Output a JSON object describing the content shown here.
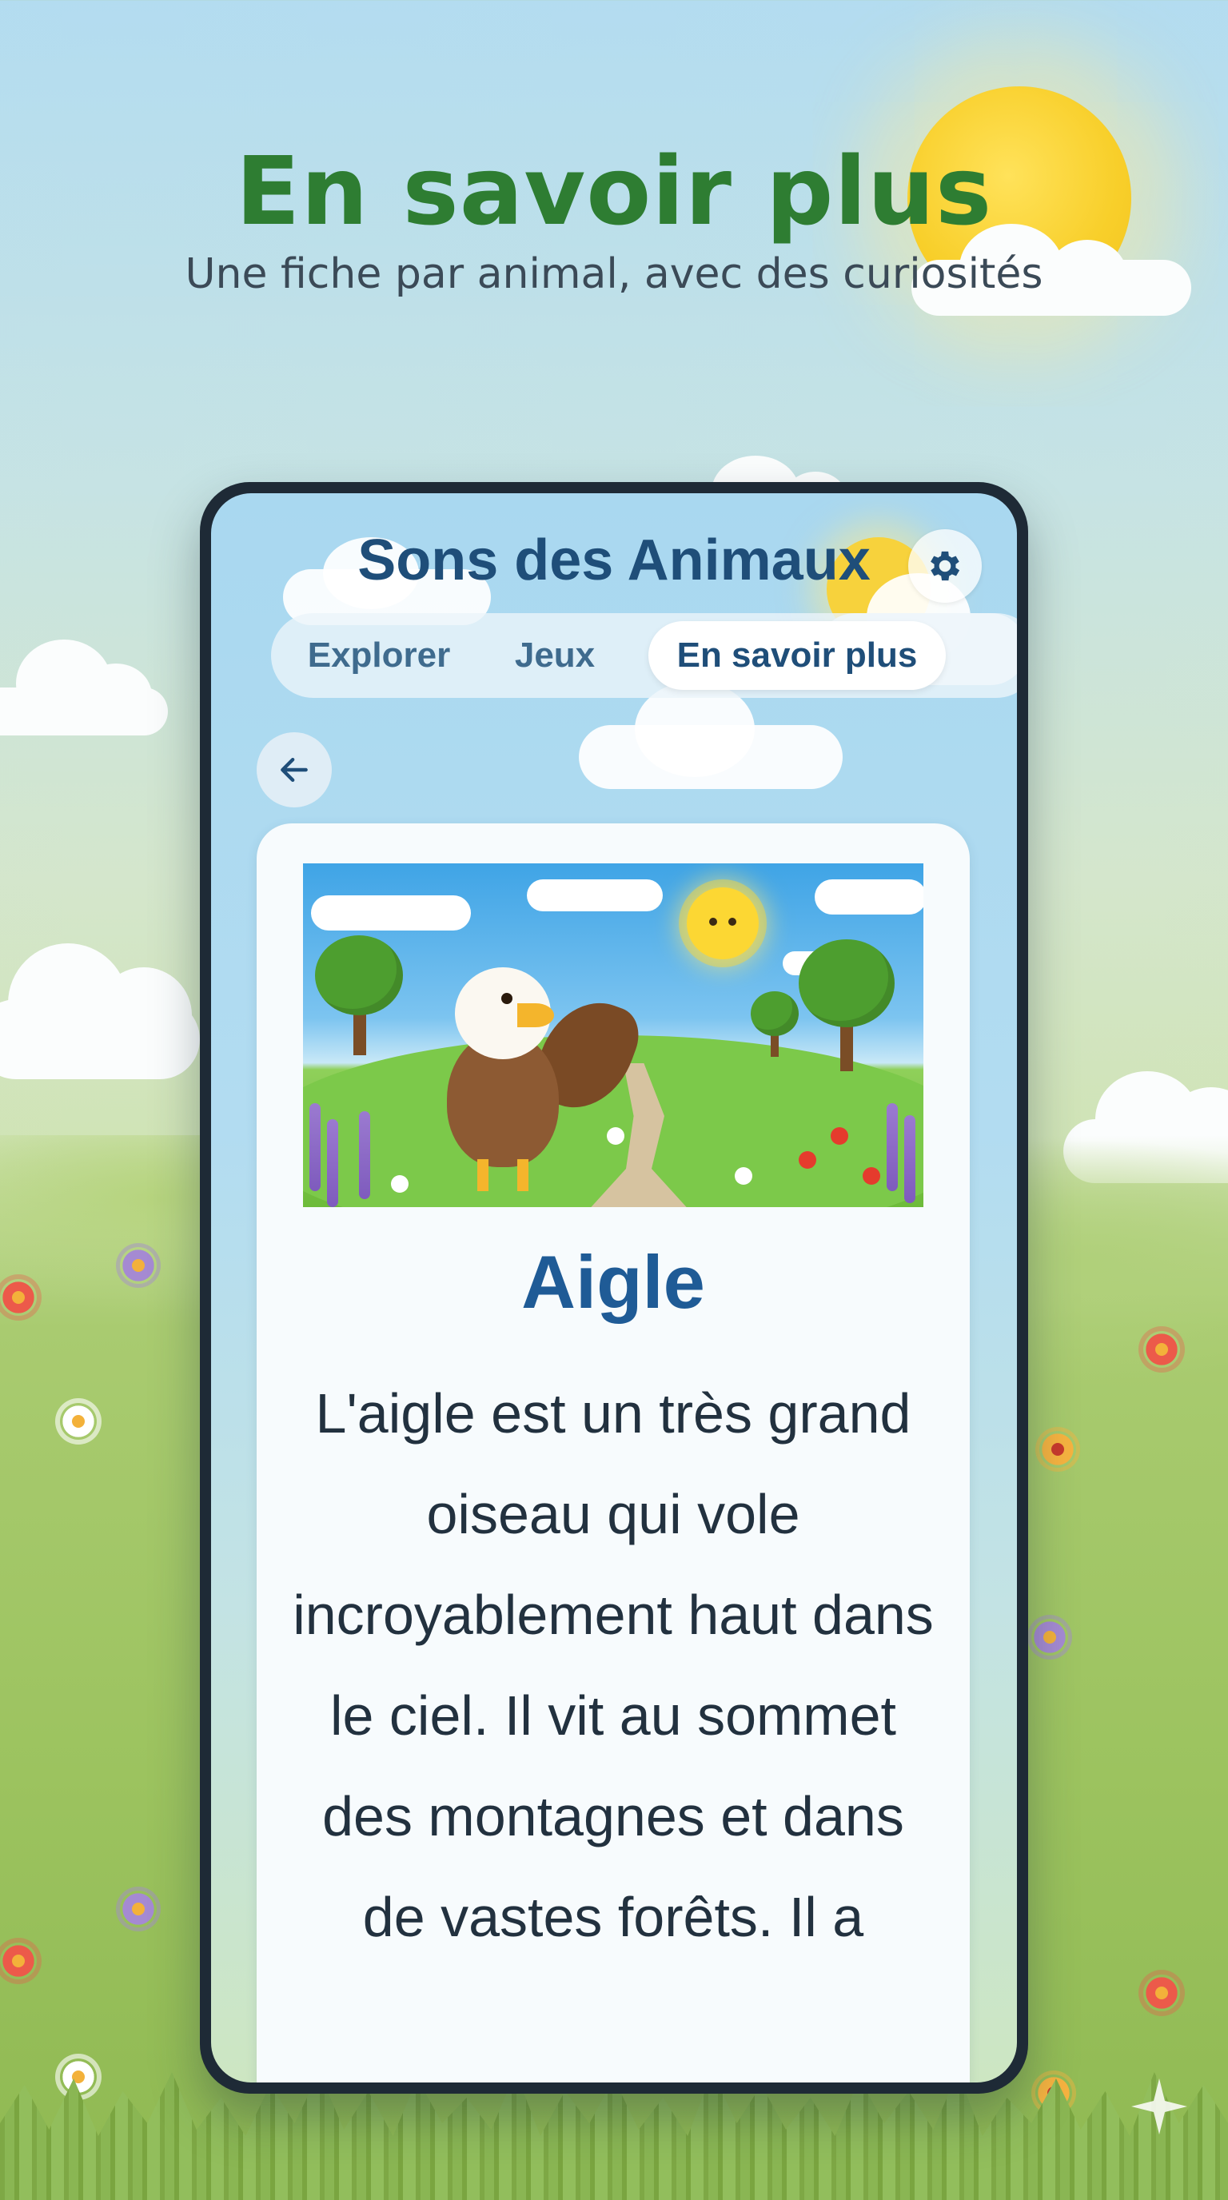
{
  "hero": {
    "title": "En savoir plus",
    "subtitle": "Une fiche par animal, avec des curiosités"
  },
  "app": {
    "title": "Sons des Animaux",
    "settings_icon": "gear-icon",
    "back_icon": "arrow-left-icon"
  },
  "tabs": [
    {
      "label": "Explorer",
      "active": false
    },
    {
      "label": "Jeux",
      "active": false
    },
    {
      "label": "En savoir plus",
      "active": true
    }
  ],
  "animal": {
    "name": "Aigle",
    "description": "L'aigle est un très grand oiseau qui vole incroyablement haut dans le ciel. Il vit au sommet des montagnes et dans de vastes forêts. Il a",
    "illustration_icon": "eagle-illustration"
  },
  "colors": {
    "headline_green": "#2e7d32",
    "app_title_blue": "#1f4e79",
    "animal_name_blue": "#1f5b96",
    "phone_frame": "#1e2a36"
  }
}
